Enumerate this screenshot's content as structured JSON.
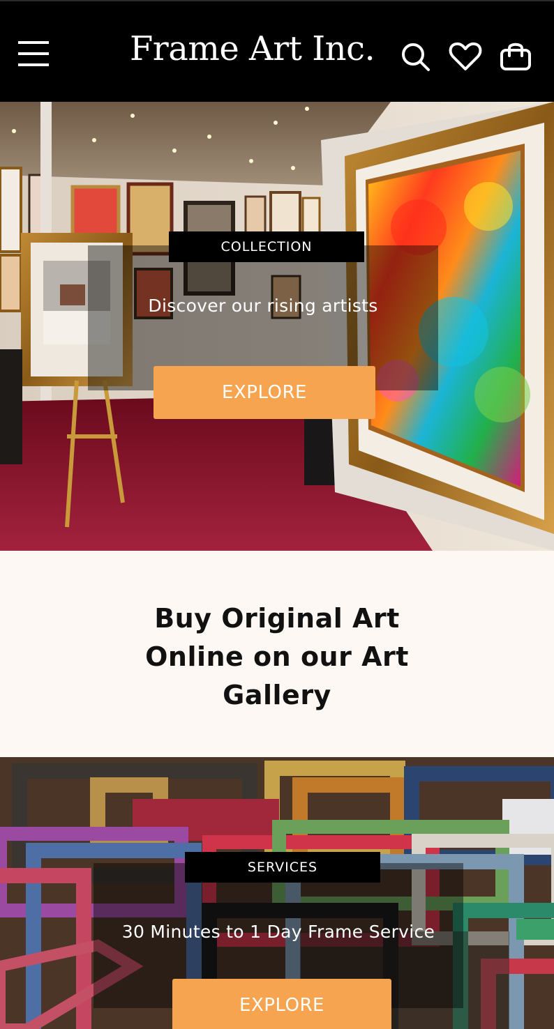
{
  "header": {
    "brand": "Frame Art Inc.",
    "icons": [
      "menu-icon",
      "search-icon",
      "heart-icon",
      "bag-icon"
    ]
  },
  "hero_collection": {
    "tag": "COLLECTION",
    "text": "Discover our rising artists",
    "button": "EXPLORE"
  },
  "headline": {
    "lines": [
      "Buy Original Art",
      "Online on our Art",
      "Gallery"
    ]
  },
  "hero_services": {
    "tag": "SERVICES",
    "text": "30 Minutes to 1 Day Frame Service",
    "button": "EXPLORE"
  },
  "colors": {
    "header_bg": "#000000",
    "accent": "#f6a450",
    "page_bg": "#fdf8f3"
  }
}
